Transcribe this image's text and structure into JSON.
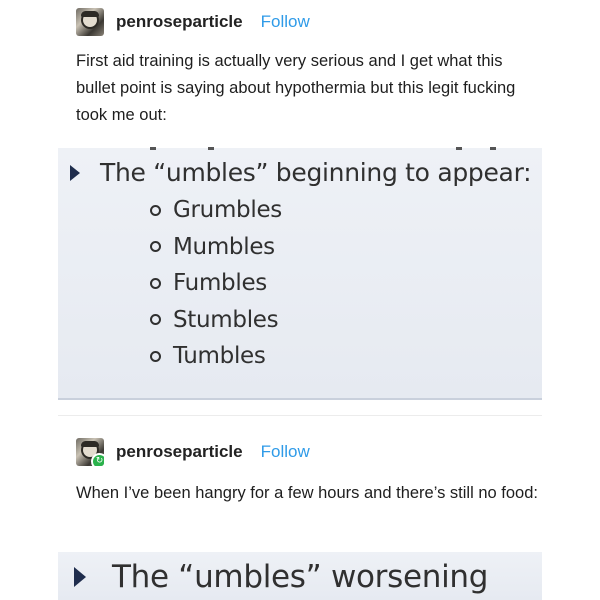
{
  "post1": {
    "username": "penroseparticle",
    "follow_label": "Follow",
    "text": "First aid training is actually very serious and I get what this bullet point is saying about hypothermia but this legit fucking took me out:",
    "slide": {
      "heading": "The “umbles” beginning to appear:",
      "items": [
        "Grumbles",
        "Mumbles",
        "Fumbles",
        "Stumbles",
        "Tumbles"
      ]
    }
  },
  "post2": {
    "username": "penroseparticle",
    "follow_label": "Follow",
    "text": "When I’ve been hangry for a few hours and there’s still no food:",
    "slide": {
      "heading": "The “umbles” worsening"
    }
  },
  "icons": {
    "avatar": "avatar-image",
    "reblog": "reblog-icon",
    "bullet": "triangle-bullet-icon",
    "sub_bullet": "ring-bullet-icon"
  },
  "colors": {
    "follow": "#2f9be8",
    "slide_background": "#eef1f6",
    "bullet": "#1f2d4d",
    "reblog_badge": "#2bb24c"
  }
}
